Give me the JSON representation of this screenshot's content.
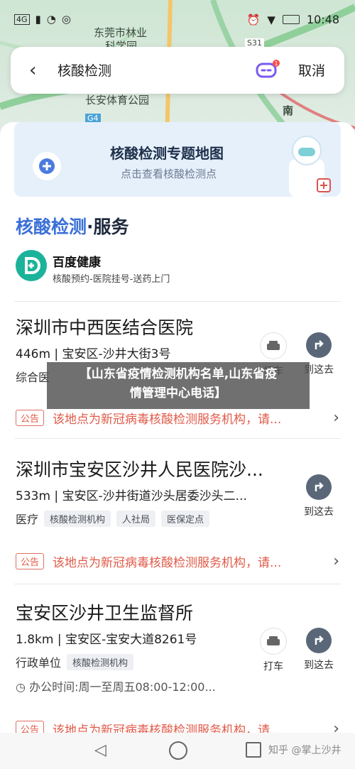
{
  "status": {
    "time": "10:48",
    "carrier_icons": [
      "sim-4g-icon",
      "signal-icon",
      "wifi-icon",
      "location-icon"
    ]
  },
  "map": {
    "labels": [
      "东莞市林业",
      "科学园",
      "长安体育公园",
      "S31",
      "G4",
      "南"
    ]
  },
  "search": {
    "query": "核酸检测",
    "cancel": "取消",
    "badge": "1"
  },
  "banner": {
    "title": "核酸检测专题地图",
    "subtitle": "点击查看核酸检测点"
  },
  "section": {
    "title_hl": "核酸检测",
    "title_rest": "·服务"
  },
  "partner": {
    "name": "百度健康",
    "desc": "核酸预约-医院挂号-送药上门"
  },
  "items": [
    {
      "name": "深圳市中西医结合医院",
      "addr": "446m | 宝安区-沙井大街3号",
      "cat": "综合医",
      "tags": [],
      "notice_badge": "公告",
      "notice": "该地点为新冠病毒核酸检测服务机构，请...",
      "taxi": "打车",
      "go": "到这去"
    },
    {
      "name": "深圳市宝安区沙井人民医院沙...",
      "addr": "533m | 宝安区-沙井街道沙头居委沙头二...",
      "cat": "医疗",
      "tags": [
        "核酸检测机构",
        "人社局",
        "医保定点"
      ],
      "notice_badge": "公告",
      "notice": "该地点为新冠病毒核酸检测服务机构，请...",
      "go": "到这去"
    },
    {
      "name": "宝安区沙井卫生监督所",
      "addr": "1.8km | 宝安区-宝安大道8261号",
      "cat": "行政单位",
      "tags": [
        "核酸检测机构"
      ],
      "hours": "办公时间:周一至周五08:00-12:00...",
      "notice_badge": "公告",
      "notice": "该地点为新冠病毒核酸检测服务机构，请...",
      "taxi": "打车",
      "go": "到这去"
    }
  ],
  "overlay": {
    "line1": "【山东省疫情检测机构名单,山东省疫",
    "line2": "情管理中心电话】"
  },
  "watermark": "知乎 @掌上沙井"
}
